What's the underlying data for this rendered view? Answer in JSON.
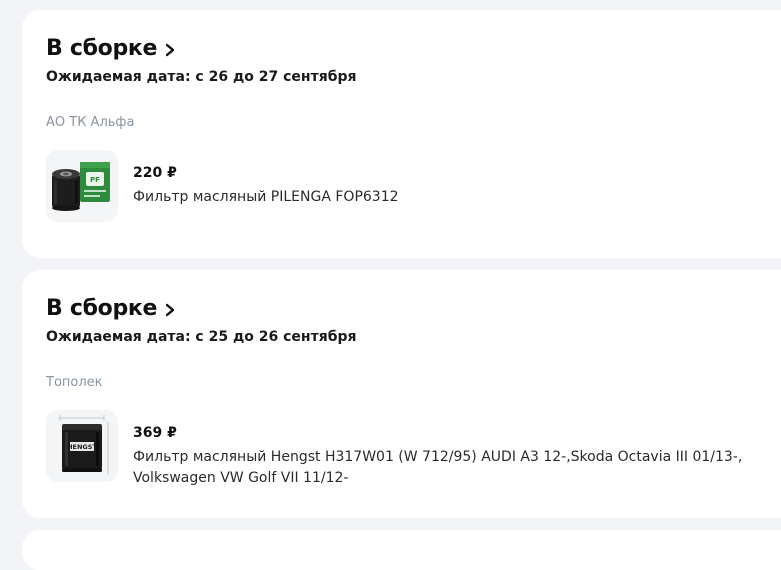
{
  "orders": [
    {
      "status_title": "В сборке",
      "expected_date": "Ожидаемая дата: с 26 до 27 сентября",
      "seller": "АО ТК Альфа",
      "item": {
        "price": "220 ₽",
        "name": "Фильтр масляный PILENGA FOP6312",
        "image_icon": "oil-filter-green-box"
      }
    },
    {
      "status_title": "В сборке",
      "expected_date": "Ожидаемая дата: с 25 до 26 сентября",
      "seller": "Тополек",
      "item": {
        "price": "369 ₽",
        "name": "Фильтр масляный Hengst H317W01 (W 712/95) AUDI A3 12-,Skoda Octavia III 01/13-, Volkswagen VW Golf VII 11/12-",
        "image_icon": "oil-filter-black"
      }
    }
  ],
  "colors": {
    "page_bg": "#f2f4f7",
    "card_bg": "#ffffff",
    "seller_text": "#8a93a0",
    "box_green": "#2e8b3d"
  }
}
